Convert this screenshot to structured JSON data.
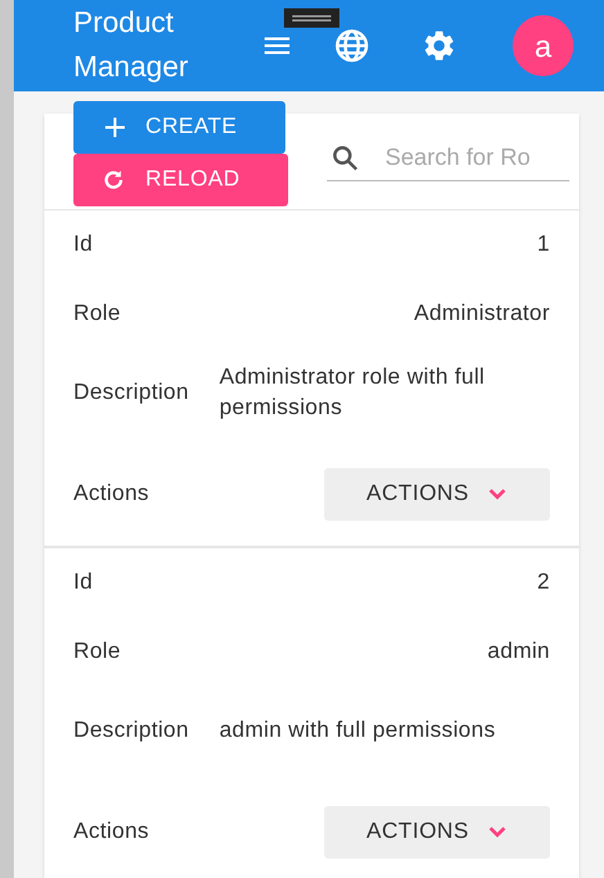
{
  "app_bar": {
    "title": "Product Manager",
    "avatar": "a"
  },
  "toolbar": {
    "create": "CREATE",
    "reload": "RELOAD",
    "search": {
      "placeholder": "Search for Ro"
    }
  },
  "records": [
    {
      "fields": [
        {
          "label": "Id",
          "value": "1"
        },
        {
          "label": "Role",
          "value": "Administrator"
        },
        {
          "label": "Description",
          "value": "Administrator role with full permissions"
        }
      ],
      "actions_label": "Actions",
      "actions_button": "ACTIONS"
    },
    {
      "fields": [
        {
          "label": "Id",
          "value": "2"
        },
        {
          "label": "Role",
          "value": "admin"
        },
        {
          "label": "Description",
          "value": "admin with full permissions"
        }
      ],
      "actions_label": "Actions",
      "actions_button": "ACTIONS"
    }
  ]
}
